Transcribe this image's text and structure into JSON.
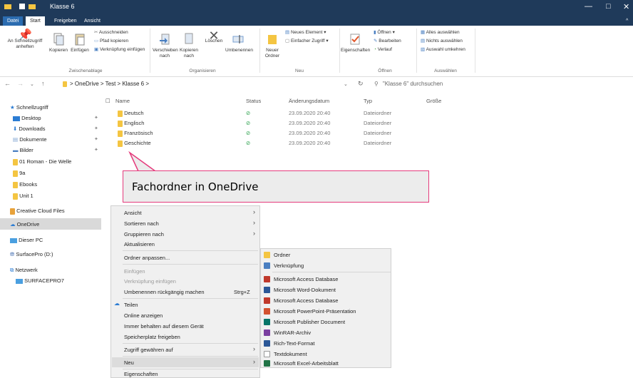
{
  "window": {
    "title": "Klasse 6",
    "minimize": "—",
    "maximize": "□",
    "close": "✕",
    "help": "^"
  },
  "tabs": [
    "Datei",
    "Start",
    "Freigeben",
    "Ansicht"
  ],
  "ribbon": {
    "pin_label": "An Schnellzugriff anheften",
    "copy_label": "Kopieren",
    "paste_label": "Einfügen",
    "cut_label": "Ausschneiden",
    "copy_path_label": "Pfad kopieren",
    "paste_link_label": "Verknüpfung einfügen",
    "group_clipboard": "Zwischenablage",
    "move_label": "Verschieben nach",
    "copyto_label": "Kopieren nach",
    "delete_label": "Löschen",
    "rename_label": "Umbenennen",
    "group_organize": "Organisieren",
    "newfolder_label": "Neuer Ordner",
    "newitem_label": "Neues Element",
    "easyaccess_label": "Einfacher Zugriff",
    "group_new": "Neu",
    "properties_label": "Eigenschaften",
    "open_label": "Öffnen",
    "edit_label": "Bearbeiten",
    "history_label": "Verlauf",
    "group_open": "Öffnen",
    "selectall_label": "Alles auswählen",
    "selectnone_label": "Nichts auswählen",
    "invert_label": "Auswahl umkehren",
    "group_select": "Auswählen"
  },
  "address": {
    "path": "> OneDrive > Test > Klasse 6 >",
    "search_placeholder": "\"Klasse 6\" durchsuchen"
  },
  "sidebar": {
    "quick_access": "Schnellzugriff",
    "items": [
      {
        "label": "Desktop",
        "pinned": true
      },
      {
        "label": "Downloads",
        "pinned": true
      },
      {
        "label": "Dokumente",
        "pinned": true
      },
      {
        "label": "Bilder",
        "pinned": true
      },
      {
        "label": "01 Roman - Die Welle",
        "pinned": false
      },
      {
        "label": "9a",
        "pinned": false
      },
      {
        "label": "Ebooks",
        "pinned": false
      },
      {
        "label": "Unit 1",
        "pinned": false
      }
    ],
    "creative_cloud": "Creative Cloud Files",
    "onedrive": "OneDrive",
    "this_pc": "Dieser PC",
    "drive": "SurfacePro (D:)",
    "network": "Netzwerk",
    "network_pc": "SURFACEPRO7"
  },
  "list": {
    "headers": {
      "name": "Name",
      "status": "Status",
      "date": "Änderungsdatum",
      "type": "Typ",
      "size": "Größe"
    },
    "rows": [
      {
        "name": "Deutsch",
        "date": "23.09.2020 20:40",
        "type": "Dateiordner"
      },
      {
        "name": "Englisch",
        "date": "23.09.2020 20:40",
        "type": "Dateiordner"
      },
      {
        "name": "Französisch",
        "date": "23.09.2020 20:40",
        "type": "Dateiordner"
      },
      {
        "name": "Geschichte",
        "date": "23.09.2020 20:40",
        "type": "Dateiordner"
      }
    ]
  },
  "callout": {
    "text": "Fachordner in OneDrive"
  },
  "context_menu": {
    "items": [
      "Ansicht",
      "Sortieren nach",
      "Gruppieren nach",
      "Aktualisieren",
      "Ordner anpassen...",
      "Einfügen",
      "Verknüpfung einfügen",
      "Umbenennen rückgängig machen",
      "Teilen",
      "Online anzeigen",
      "Immer behalten auf diesem Gerät",
      "Speicherplatz freigeben",
      "Zugriff gewähren auf",
      "Neu",
      "Eigenschaften"
    ],
    "undo_shortcut": "Strg+Z"
  },
  "submenu": {
    "items": [
      "Ordner",
      "Verknüpfung",
      "Microsoft Access Database",
      "Microsoft Word-Dokument",
      "Microsoft Access Database",
      "Microsoft PowerPoint-Präsentation",
      "Microsoft Publisher Document",
      "WinRAR-Archiv",
      "Rich-Text-Format",
      "Textdokument",
      "Microsoft Excel-Arbeitsblatt"
    ]
  }
}
